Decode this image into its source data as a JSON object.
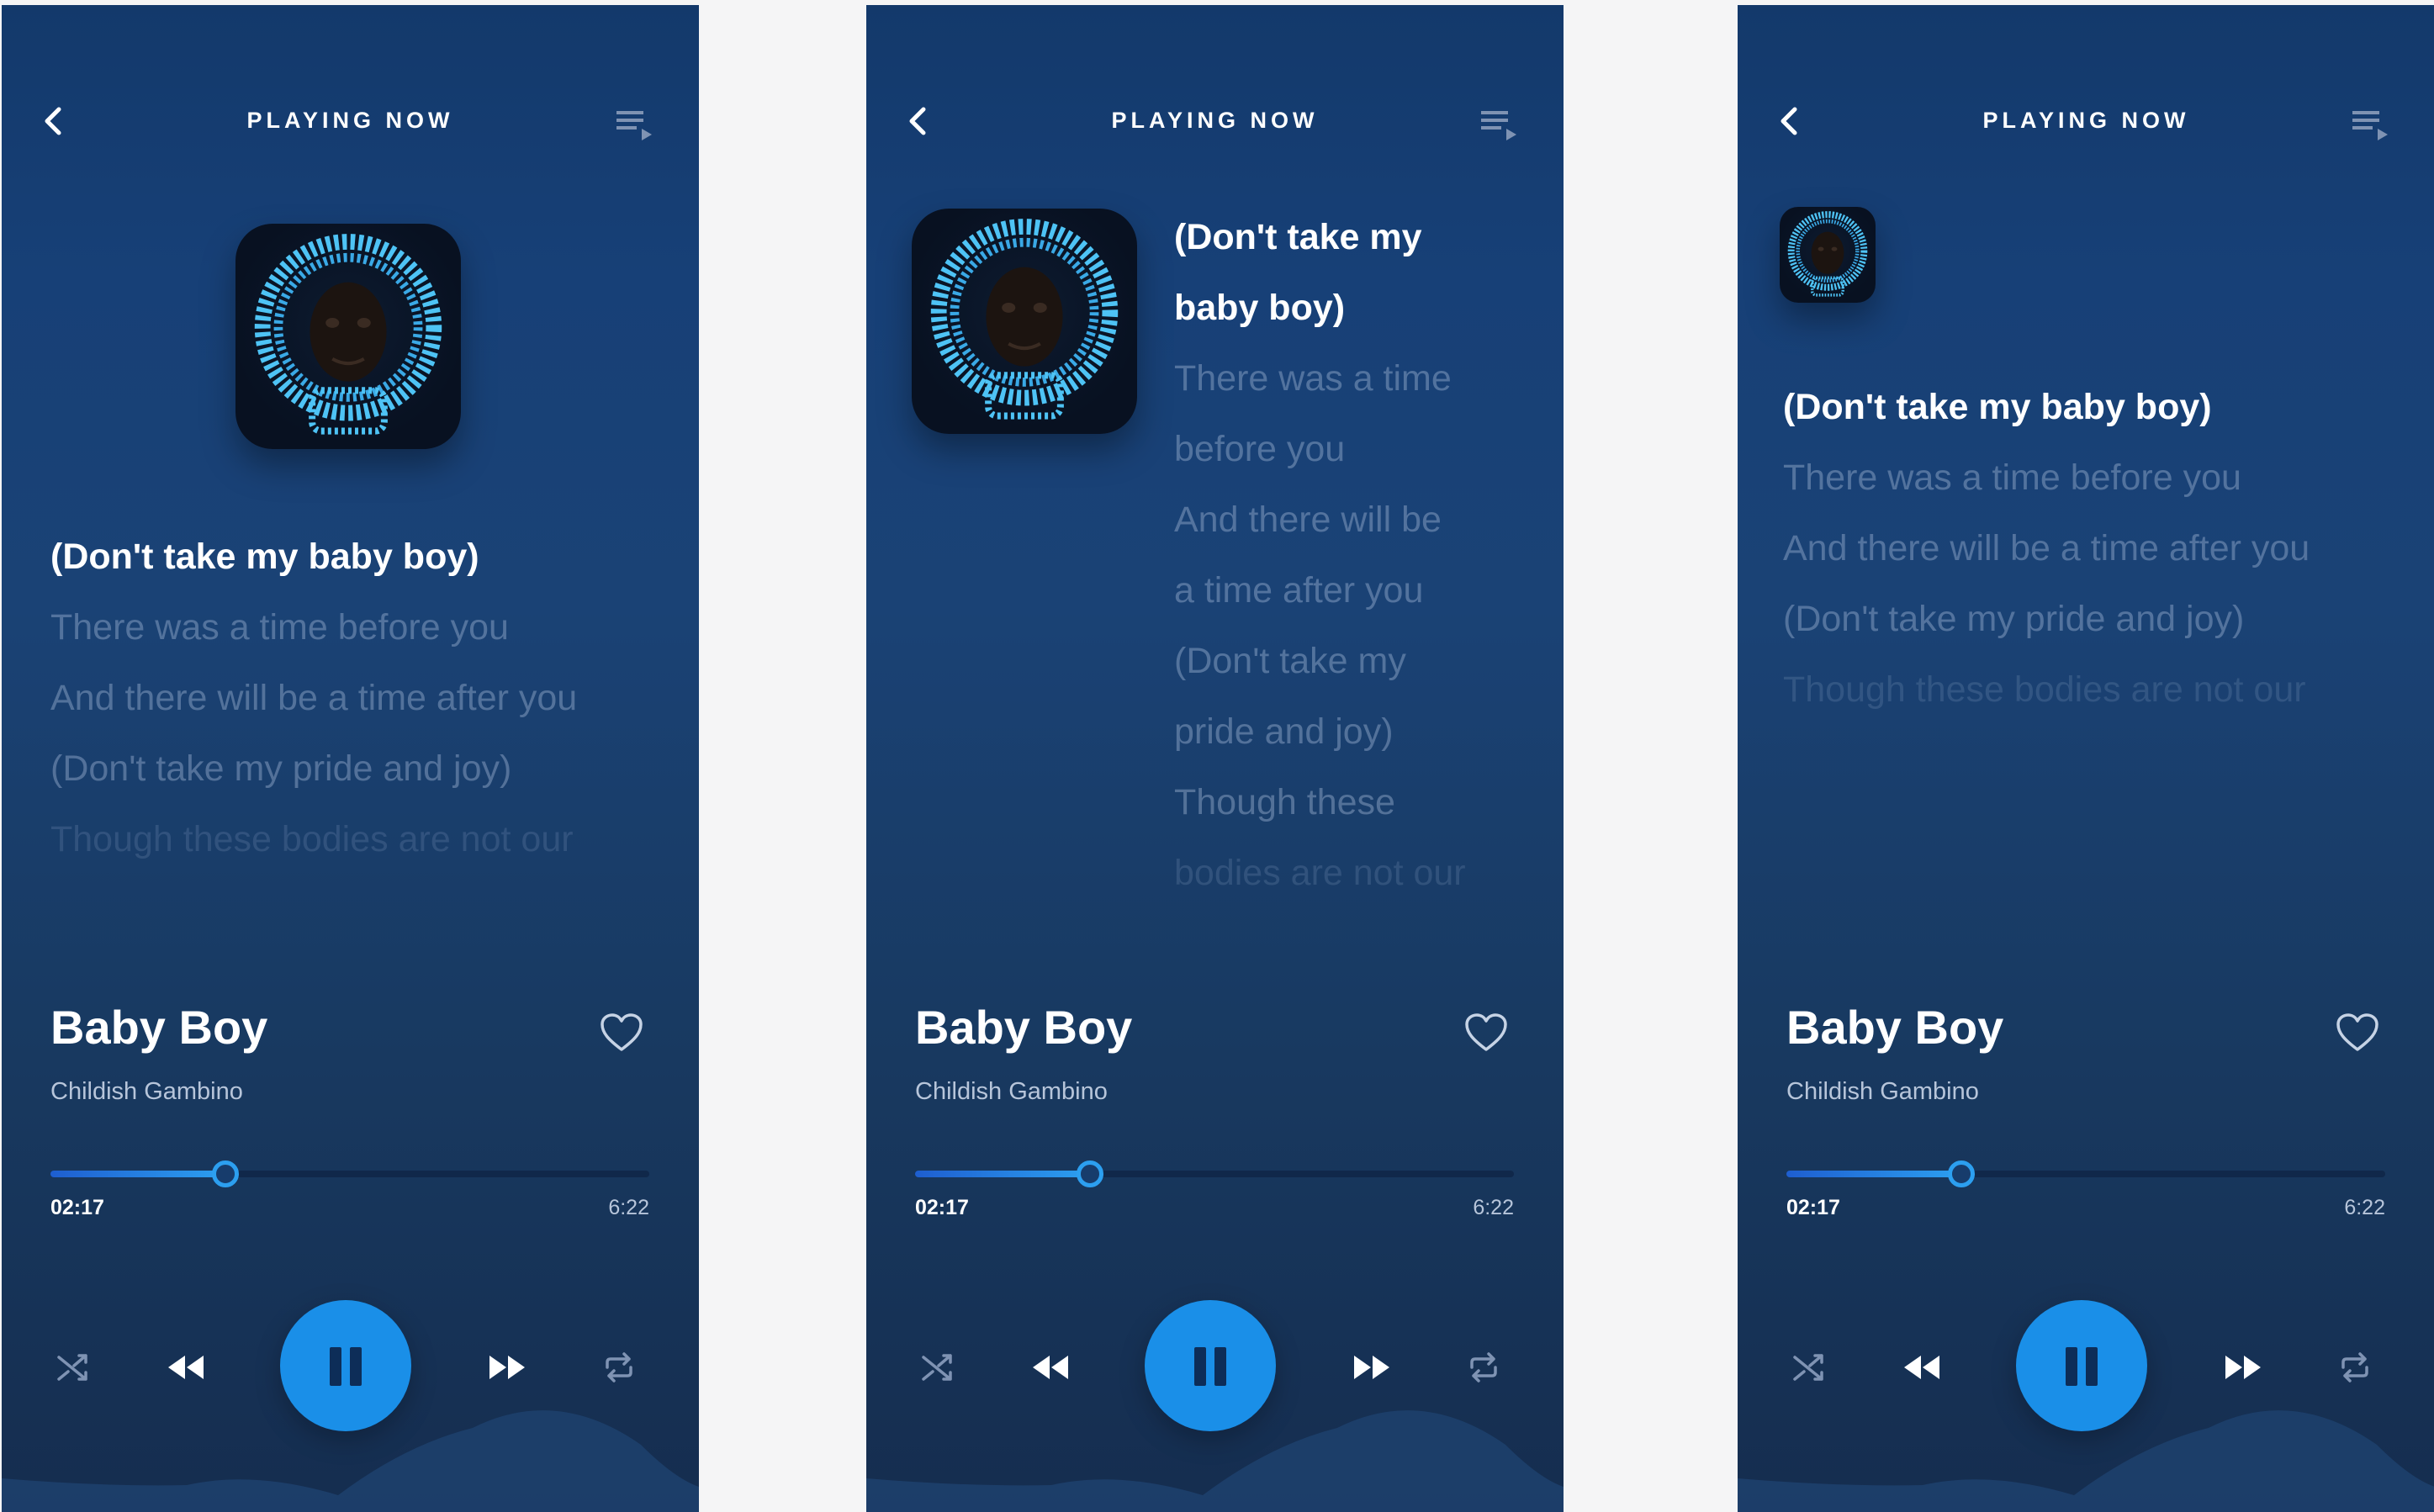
{
  "screens": [
    {
      "header": {
        "title": "PLAYING NOW",
        "back_icon": "chevron-left-icon",
        "queue_icon": "playlist-icon"
      },
      "lyrics": [
        "(Don't take my baby boy)",
        "There was a time before you",
        "And there will be a time after you",
        "(Don't take my pride and joy)",
        "Though these bodies are not our"
      ],
      "track": {
        "title": "Baby Boy",
        "artist": "Childish Gambino"
      },
      "progress": {
        "current": "02:17",
        "total": "6:22",
        "fraction": 0.29
      }
    },
    {
      "header": {
        "title": "PLAYING NOW",
        "back_icon": "chevron-left-icon",
        "queue_icon": "playlist-icon"
      },
      "lyrics": [
        "(Don't take my",
        "baby boy)",
        "There was a time",
        "before you",
        "And there will be",
        "a time after you",
        "(Don't take my",
        "pride and joy)",
        "Though these",
        "bodies are not our"
      ],
      "track": {
        "title": "Baby Boy",
        "artist": "Childish Gambino"
      },
      "progress": {
        "current": "02:17",
        "total": "6:22",
        "fraction": 0.29
      }
    },
    {
      "header": {
        "title": "PLAYING NOW",
        "back_icon": "chevron-left-icon",
        "queue_icon": "playlist-icon"
      },
      "lyrics": [
        "(Don't take my baby boy)",
        "There was a time before you",
        "And there will be a time after you",
        "(Don't take my pride and joy)",
        "Though these bodies are not our"
      ],
      "track": {
        "title": "Baby Boy",
        "artist": "Childish Gambino"
      },
      "progress": {
        "current": "02:17",
        "total": "6:22",
        "fraction": 0.29
      }
    }
  ],
  "controls": [
    "shuffle-icon",
    "rewind-icon",
    "pause-icon",
    "fast-forward-icon",
    "repeat-icon"
  ],
  "colors": {
    "accent": "#1a8fe8",
    "background_top": "#13396b",
    "background_bottom": "#152d4f",
    "page": "#f5f5f6"
  }
}
